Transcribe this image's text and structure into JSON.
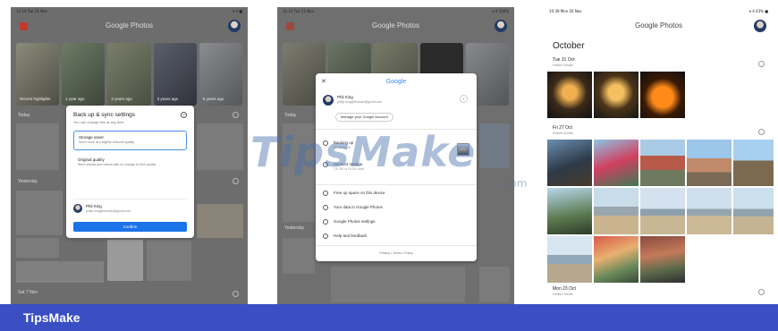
{
  "footer": {
    "brand": "TipsMake"
  },
  "watermark": {
    "main": "TipsMake",
    "suffix": ".com"
  },
  "colors": {
    "footer_bg": "#3a4fc4",
    "accent_blue": "#1a73e8"
  },
  "panel1": {
    "status_left": "11:14  Tue 21 Nov",
    "status_right": "▾ 4 ■",
    "app_title": "Google Photos",
    "thumb_caps": [
      "Recent highlights",
      "1 year ago",
      "2 years ago",
      "3 years ago",
      "5 years ago"
    ],
    "section_today": "Today",
    "section_yesterday": "Yesterday",
    "section_sat": "Sat 7 Nov",
    "dialog": {
      "title": "Back up & sync settings",
      "subtitle": "You can change this at any time",
      "option1_title": "Storage saver",
      "option1_desc": "Store more at a slightly reduced quality",
      "option2_title": "Original quality",
      "option2_desc": "Store photos and videos with no change to their quality",
      "account_name": "Phil King",
      "account_email": "philip.king@domain@gmail.com",
      "confirm_label": "Confirm"
    }
  },
  "panel2": {
    "status_left": "11:14  Tue 21 Nov",
    "status_right": "▾ 4 100%",
    "app_title": "Google Photos",
    "section_today": "Today",
    "section_yesterday": "Yesterday",
    "sheet": {
      "logo": "Google",
      "name": "Phil King",
      "email": "philip.king@domain@gmail.com",
      "manage_label": "Manage your Google Account",
      "rows": [
        {
          "label": "Backing up",
          "sub": "49 items left"
        },
        {
          "label": "Account storage",
          "sub": "1.8 GB of 15 GB used"
        },
        {
          "label": "Free up space on this device",
          "sub": ""
        },
        {
          "label": "Your data in Google Photos",
          "sub": ""
        },
        {
          "label": "Google Photos settings",
          "sub": ""
        },
        {
          "label": "Help and feedback",
          "sub": ""
        }
      ],
      "footer": "Privacy  •  Terms  •  Policy"
    }
  },
  "panel3": {
    "status_left": "10:39  Mon 20 Nov",
    "status_right": "▾ 4 43% ■",
    "app_title": "Google Photos",
    "month": "October",
    "groups": [
      {
        "date": "Tue 31 Oct",
        "place": "Hellion Heath"
      },
      {
        "date": "Fri 27 Oct",
        "place": "Dorset AONB"
      },
      {
        "date": "Mon 23 Oct",
        "place": "Hellion Heath"
      }
    ]
  }
}
